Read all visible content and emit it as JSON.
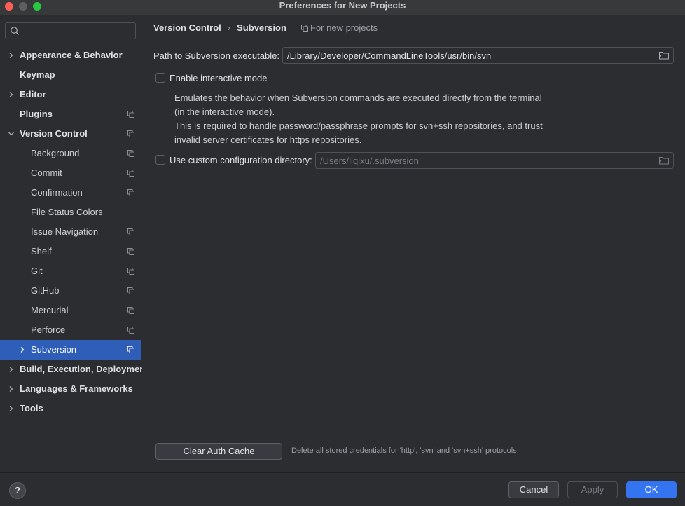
{
  "window": {
    "title": "Preferences for New Projects"
  },
  "search": {
    "placeholder": "",
    "value": ""
  },
  "sidebar": {
    "items": [
      {
        "label": "Appearance & Behavior",
        "level": 0,
        "expandable": true,
        "project": false
      },
      {
        "label": "Keymap",
        "level": 0,
        "expandable": false,
        "project": false
      },
      {
        "label": "Editor",
        "level": 0,
        "expandable": true,
        "project": false
      },
      {
        "label": "Plugins",
        "level": 0,
        "expandable": false,
        "project": true
      },
      {
        "label": "Version Control",
        "level": 0,
        "expandable": true,
        "expanded": true,
        "project": true
      },
      {
        "label": "Background",
        "level": 1,
        "expandable": false,
        "project": true
      },
      {
        "label": "Commit",
        "level": 1,
        "expandable": false,
        "project": true
      },
      {
        "label": "Confirmation",
        "level": 1,
        "expandable": false,
        "project": true
      },
      {
        "label": "File Status Colors",
        "level": 1,
        "expandable": false,
        "project": false
      },
      {
        "label": "Issue Navigation",
        "level": 1,
        "expandable": false,
        "project": true
      },
      {
        "label": "Shelf",
        "level": 1,
        "expandable": false,
        "project": true
      },
      {
        "label": "Git",
        "level": 1,
        "expandable": false,
        "project": true
      },
      {
        "label": "GitHub",
        "level": 1,
        "expandable": false,
        "project": true
      },
      {
        "label": "Mercurial",
        "level": 1,
        "expandable": false,
        "project": true
      },
      {
        "label": "Perforce",
        "level": 1,
        "expandable": false,
        "project": true
      },
      {
        "label": "Subversion",
        "level": 1,
        "expandable": true,
        "project": true,
        "selected": true
      },
      {
        "label": "Build, Execution, Deployment",
        "level": 0,
        "expandable": true,
        "project": false
      },
      {
        "label": "Languages & Frameworks",
        "level": 0,
        "expandable": true,
        "project": false
      },
      {
        "label": "Tools",
        "level": 0,
        "expandable": true,
        "project": false
      }
    ]
  },
  "breadcrumb": {
    "parent": "Version Control",
    "separator": "›",
    "current": "Subversion",
    "scope": "For new projects"
  },
  "settings": {
    "path_label": "Path to Subversion executable:",
    "path_value": "/Library/Developer/CommandLineTools/usr/bin/svn",
    "interactive_label": "Enable interactive mode",
    "interactive_checked": false,
    "interactive_desc_1": "Emulates the behavior when Subversion commands are executed directly from the terminal (in the interactive mode).",
    "interactive_desc_2": "This is required to handle password/passphrase prompts for svn+ssh repositories, and trust invalid server certificates for https repositories.",
    "custom_dir_label": "Use custom configuration directory:",
    "custom_dir_checked": false,
    "custom_dir_value": "/Users/liqixu/.subversion"
  },
  "auth": {
    "button_label": "Clear Auth Cache",
    "hint": "Delete all stored credentials for 'http', 'svn' and 'svn+ssh' protocols"
  },
  "footer": {
    "help": "?",
    "cancel": "Cancel",
    "apply": "Apply",
    "ok": "OK"
  },
  "colors": {
    "accent": "#3574f0",
    "selection": "#2e5eb8",
    "background": "#2b2d30"
  }
}
